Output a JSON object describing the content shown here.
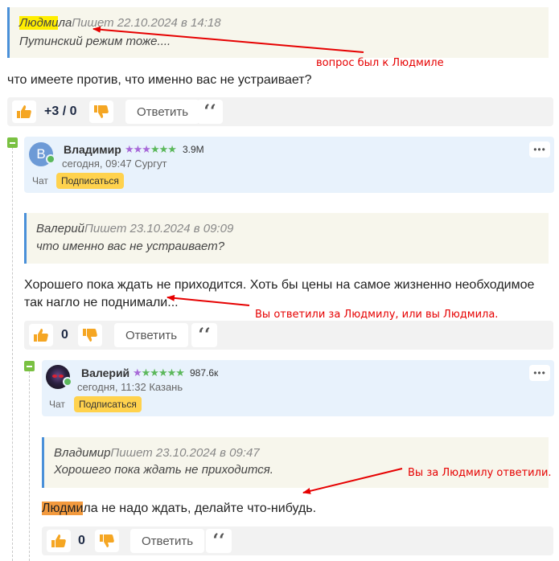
{
  "comment1": {
    "quote_author_hl": "Людми",
    "quote_author_rest": "ла",
    "quote_meta": "Пишет 22.10.2024 в 14:18",
    "quote_text": "Путинский режим тоже....",
    "body": "что имеете против, что именно вас не устраивает?",
    "score": "+3 / 0",
    "reply_label": "Ответить",
    "quote_icon": "‘‘"
  },
  "comment2": {
    "user": {
      "name": "Владимир",
      "initial": "В",
      "karma": "3.9M",
      "meta": "сегодня, 09:47  Сургут",
      "chat": "Чат",
      "subscribe": "Подписаться",
      "menu": "•••"
    },
    "quote_author": "Валерий",
    "quote_meta": "Пишет 23.10.2024 в 09:09",
    "quote_text": "что именно вас не устраивает?",
    "body_line1": "Хорошего пока ждать не приходится. Хоть бы цены на самое жизненно необходимое",
    "body_line2": "так нагло не поднимали...",
    "score": "0",
    "reply_label": "Ответить",
    "quote_icon": "‘‘"
  },
  "comment3": {
    "user": {
      "name": "Валерий",
      "karma": "987.6к",
      "meta": "сегодня, 11:32  Казань",
      "chat": "Чат",
      "subscribe": "Подписаться",
      "menu": "•••"
    },
    "quote_author": "Владимир",
    "quote_meta": "Пишет 23.10.2024 в 09:47",
    "quote_text": "Хорошего пока ждать не приходится.",
    "body_hl": "Людми",
    "body_rest": "ла не надо ждать, делайте что-нибудь.",
    "score": "0",
    "reply_label": "Ответить",
    "quote_icon": "‘‘"
  },
  "annotations": {
    "a1": "вопрос был к Людмиле",
    "a2": "Вы ответили за Людмилу, или вы Людмила.",
    "a3": "Вы за Людмилу ответили."
  },
  "colors": {
    "accent_blue": "#4a90d9",
    "green": "#5cb85c",
    "subscribe": "#ffd24d",
    "thumb": "#f5a623",
    "annotation": "#e60000"
  }
}
